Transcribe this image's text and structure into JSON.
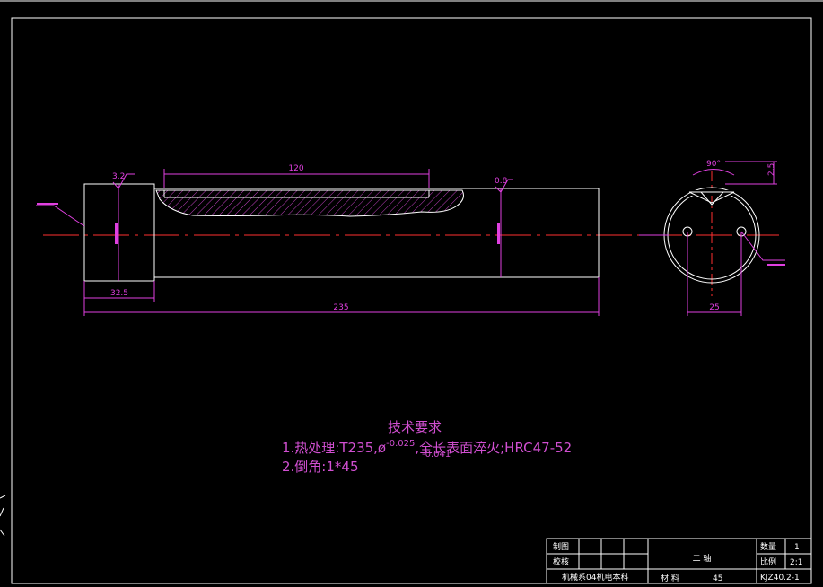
{
  "colors": {
    "background": "#000000",
    "outline": "#ffffff",
    "dimension": "#e040e0",
    "centerline": "#ff3030",
    "hatch": "#c040c0",
    "text": "#d14fd1"
  },
  "dimensions": {
    "total_length": "235",
    "head_length": "32.5",
    "flat_length": "120",
    "roughness_head": "3.2",
    "roughness_body": "0.8",
    "angle": "90°",
    "end_spacing": "25",
    "small_v": "2.5"
  },
  "tech_requirements": {
    "title": "技术要求",
    "line1_prefix": "1.热处理:T235,ø",
    "tol_upper": "-0.025",
    "tol_lower": "-0.041",
    "line1_suffix": ",全长表面淬火;HRC47-52",
    "line2": "2.倒角:1*45"
  },
  "title_block": {
    "drawn": "制图",
    "checked": "校核",
    "dept": "机械系04机电本科",
    "part_name": "二 轴",
    "material_label": "材 料",
    "material": "45",
    "qty_label": "数量",
    "qty": "1",
    "scale_label": "比例",
    "scale": "2:1",
    "drawing_no": "KJZ40.2-1"
  }
}
